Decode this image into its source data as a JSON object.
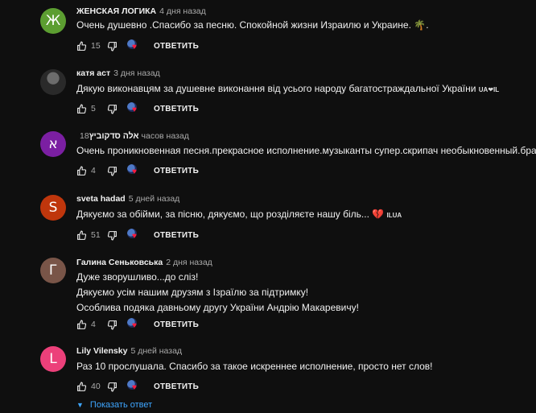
{
  "comments": [
    {
      "avatar_letter": "Ж",
      "avatar_color": "#5c9e31",
      "author": "ЖЕНСКАЯ ЛОГИКА",
      "time": "4 дня назад",
      "lines": [
        "Очень душевно .Спасибо за песню. Спокойной жизни Израилю и Украине. 🌴."
      ],
      "likes": "15",
      "reply": "ОТВЕТИТЬ"
    },
    {
      "avatar_letter": "",
      "avatar_color": "#2a2a2a",
      "author": "катя аст",
      "time": "3 дня назад",
      "lines": [
        "Дякую виконавцям за душевне виконання від усього народу багатостраждальної України"
      ],
      "flag_text": "UA❤IL",
      "likes": "5",
      "reply": "ОТВЕТИТЬ"
    },
    {
      "avatar_letter": "א",
      "avatar_color": "#7b1fa2",
      "author": "אלה סדקוביץ",
      "time": "18 часов назад",
      "lines": [
        "Очень проникновенная песня.прекрасное исполнение.музыканты супер.скрипач необыкновенный.браво"
      ],
      "likes": "4",
      "reply": "ОТВЕТИТЬ"
    },
    {
      "avatar_letter": "S",
      "avatar_color": "#bf360c",
      "author": "sveta hadad",
      "time": "5 дней назад",
      "lines": [
        "Дякуємо за обійми, за пісню, дякуємо, що розділяєте нашу біль... 💔"
      ],
      "flag_text": "ILUA",
      "likes": "51",
      "reply": "ОТВЕТИТЬ"
    },
    {
      "avatar_letter": "Г",
      "avatar_color": "#795548",
      "author": "Галина Сеньковська",
      "time": "2 дня назад",
      "lines": [
        "Дуже зворушливо...до сліз!",
        "Дякуємо усім нашим друзям з Ізраїлю за підтримку!",
        "Особлива подяка давньому другу України Андрію Макаревичу!"
      ],
      "likes": "4",
      "reply": "ОТВЕТИТЬ"
    },
    {
      "avatar_letter": "L",
      "avatar_color": "#ec407a",
      "author": "Lily Vilensky",
      "time": "5 дней назад",
      "lines": [
        "Раз 10 прослушала. Спасибо за такое искреннее исполнение,  просто нет слов!"
      ],
      "likes": "40",
      "reply": "ОТВЕТИТЬ"
    }
  ],
  "show_replies": "Показать ответ",
  "colors": {
    "background": "#0f0f0f",
    "link": "#3ea6ff",
    "heart": "#ff1a3c"
  },
  "icons": {
    "like": "thumb-up-icon",
    "dislike": "thumb-down-icon",
    "hearted": "creator-heart-icon",
    "expand": "caret-down-icon"
  }
}
